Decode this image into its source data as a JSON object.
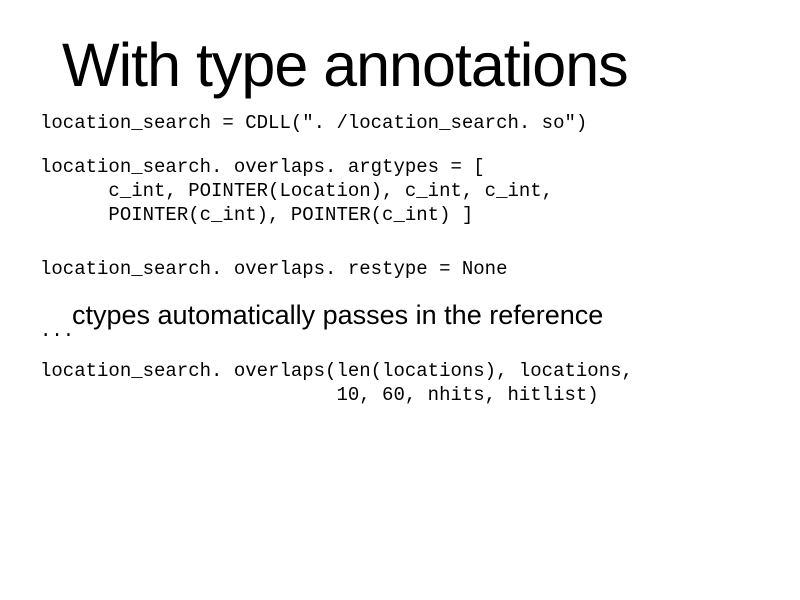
{
  "title": "With type annotations",
  "code": {
    "line1": "location_search = CDLL(\". /location_search. so\")",
    "block2": "location_search. overlaps. argtypes = [\n      c_int, POINTER(Location), c_int, c_int,\n      POINTER(c_int), POINTER(c_int) ]",
    "line3": "location_search. overlaps. restype = None",
    "ellipsis": "...",
    "block4": "location_search. overlaps(len(locations), locations,\n                          10, 60, nhits, hitlist)"
  },
  "subcaption": "ctypes automatically passes in the reference"
}
